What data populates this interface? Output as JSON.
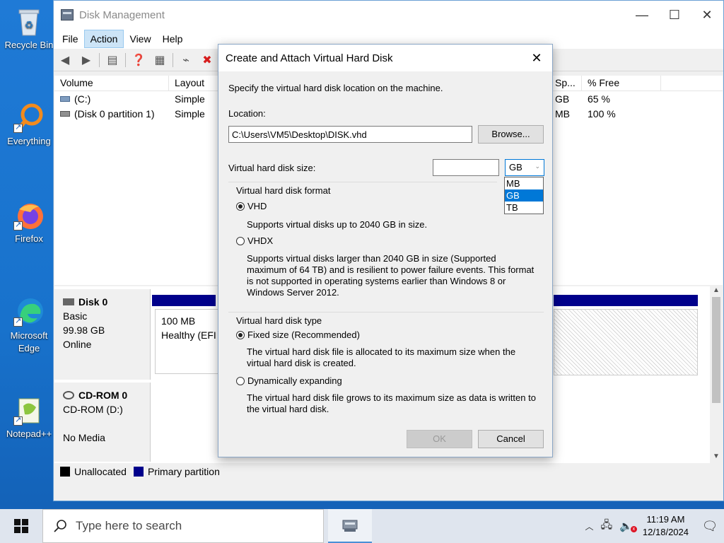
{
  "desktop": {
    "icons": [
      {
        "label": "Recycle Bin"
      },
      {
        "label": "Everything"
      },
      {
        "label": "Firefox"
      },
      {
        "label": "Microsoft Edge"
      },
      {
        "label": "Notepad++"
      }
    ]
  },
  "window": {
    "title": "Disk Management",
    "menu": [
      "File",
      "Action",
      "View",
      "Help"
    ],
    "columns": [
      "Volume",
      "Layout",
      "Sp...",
      "% Free"
    ],
    "volumes": [
      {
        "name": "(C:)",
        "layout": "Simple",
        "space": "GB",
        "free": "65 %"
      },
      {
        "name": "(Disk 0 partition 1)",
        "layout": "Simple",
        "space": "MB",
        "free": "100 %"
      }
    ],
    "disks": [
      {
        "name": "Disk 0",
        "type": "Basic",
        "size": "99.98 GB",
        "status": "Online",
        "partition_size": "100 MB",
        "partition_status": "Healthy (EFI"
      },
      {
        "name": "CD-ROM 0",
        "type": "CD-ROM (D:)",
        "status": "No Media"
      }
    ],
    "legend": {
      "unallocated": "Unallocated",
      "primary": "Primary partition"
    },
    "colors": {
      "primary": "#00008b",
      "unallocated": "#000000"
    }
  },
  "dialog": {
    "title": "Create and Attach Virtual Hard Disk",
    "intro": "Specify the virtual hard disk location on the machine.",
    "location_label": "Location:",
    "location_value": "C:\\Users\\VM5\\Desktop\\DISK.vhd",
    "browse_label": "Browse...",
    "size_label": "Virtual hard disk size:",
    "size_value": "",
    "unit_selected": "GB",
    "unit_options": [
      "MB",
      "GB",
      "TB"
    ],
    "format_group": "Virtual hard disk format",
    "vhd_label": "VHD",
    "vhd_desc": "Supports virtual disks up to 2040 GB in size.",
    "vhdx_label": "VHDX",
    "vhdx_desc": "Supports virtual disks larger than 2040 GB in size (Supported maximum of 64 TB) and is resilient to power failure events. This format is not supported in operating systems earlier than Windows 8 or Windows Server 2012.",
    "type_group": "Virtual hard disk type",
    "fixed_label": "Fixed size (Recommended)",
    "fixed_desc": "The virtual hard disk file is allocated to its maximum size when the virtual hard disk is created.",
    "dynamic_label": "Dynamically expanding",
    "dynamic_desc": "The virtual hard disk file grows to its maximum size as data is written to the virtual hard disk.",
    "ok_label": "OK",
    "cancel_label": "Cancel"
  },
  "taskbar": {
    "search_placeholder": "Type here to search",
    "time": "11:19 AM",
    "date": "12/18/2024"
  }
}
